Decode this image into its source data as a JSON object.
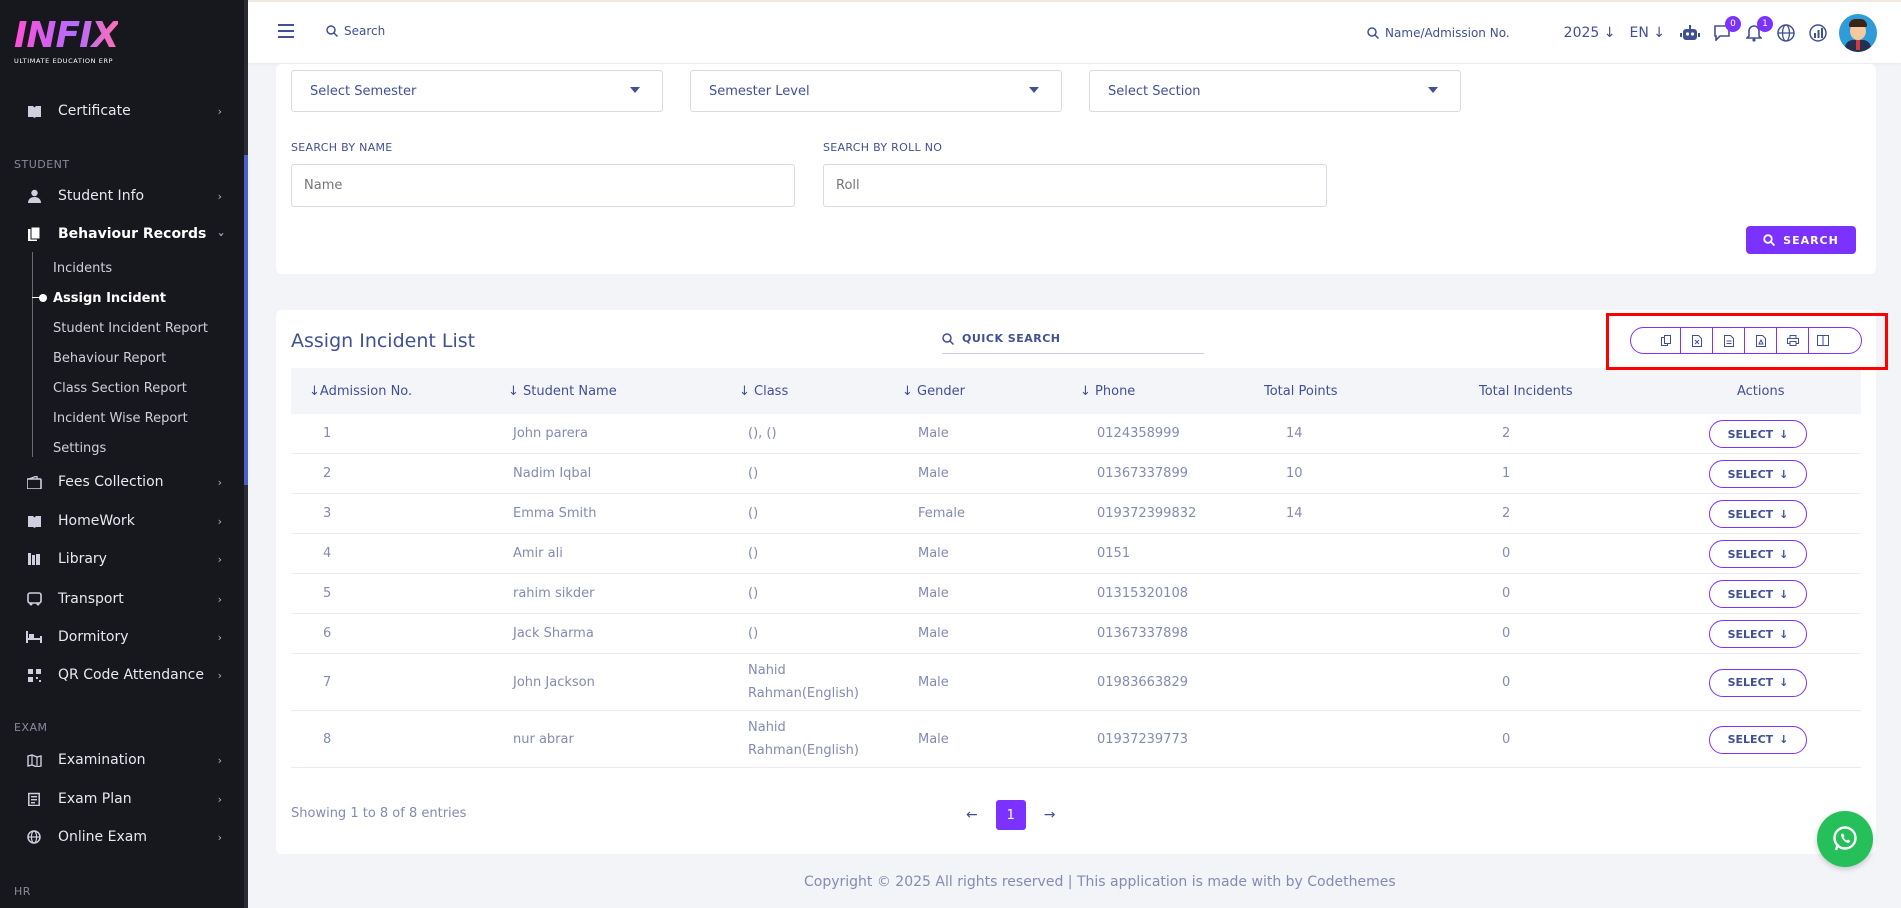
{
  "brand": {
    "logo": "INFIX",
    "tagline": "ULTIMATE EDUCATION ERP"
  },
  "sidebar": {
    "certificate": "Certificate",
    "section_student": "STUDENT",
    "student_info": "Student Info",
    "behaviour_records": "Behaviour Records",
    "sub": [
      "Incidents",
      "Assign Incident",
      "Student Incident Report",
      "Behaviour Report",
      "Class Section Report",
      "Incident Wise Report",
      "Settings"
    ],
    "fees_collection": "Fees Collection",
    "homework": "HomeWork",
    "library": "Library",
    "transport": "Transport",
    "dormitory": "Dormitory",
    "qr_attendance": "QR Code Attendance",
    "section_exam": "EXAM",
    "examination": "Examination",
    "exam_plan": "Exam Plan",
    "online_exam": "Online Exam",
    "section_hr": "HR"
  },
  "topbar": {
    "search": "Search",
    "name_search": "Name/Admission No.",
    "year": "2025",
    "lang": "EN",
    "chat_badge": "0",
    "notif_badge": "1"
  },
  "filters": {
    "semester": "Select Semester",
    "semester_level": "Semester Level",
    "section": "Select Section",
    "name_label": "SEARCH BY NAME",
    "name_placeholder": "Name",
    "roll_label": "SEARCH BY ROLL NO",
    "roll_placeholder": "Roll",
    "search_btn": "SEARCH"
  },
  "list": {
    "title": "Assign Incident List",
    "quick_search": "QUICK SEARCH",
    "columns": [
      "Admission No.",
      "Student Name",
      "Class",
      "Gender",
      "Phone",
      "Total Points",
      "Total Incidents",
      "Actions"
    ],
    "rows": [
      [
        "1",
        "John parera",
        "(), ()",
        "Male",
        "0124358999",
        "14",
        "2"
      ],
      [
        "2",
        "Nadim Iqbal",
        "()",
        "Male",
        "01367337899",
        "10",
        "1"
      ],
      [
        "3",
        "Emma Smith",
        "()",
        "Female",
        "019372399832",
        "14",
        "2"
      ],
      [
        "4",
        "Amir ali",
        "()",
        "Male",
        "0151",
        "",
        "0"
      ],
      [
        "5",
        "rahim sikder",
        "()",
        "Male",
        "01315320108",
        "",
        "0"
      ],
      [
        "6",
        "Jack Sharma",
        "()",
        "Male",
        "01367337898",
        "",
        "0"
      ],
      [
        "7",
        "John Jackson",
        "Nahid Rahman(English)",
        "Male",
        "01983663829",
        "",
        "0"
      ],
      [
        "8",
        "nur abrar",
        "Nahid Rahman(English)",
        "Male",
        "01937239773",
        "",
        "0"
      ]
    ],
    "select_label": "SELECT",
    "showing": "Showing 1 to 8 of 8 entries",
    "page": "1"
  },
  "footer": "Copyright © 2025 All rights reserved | This application is made with by Codethemes"
}
